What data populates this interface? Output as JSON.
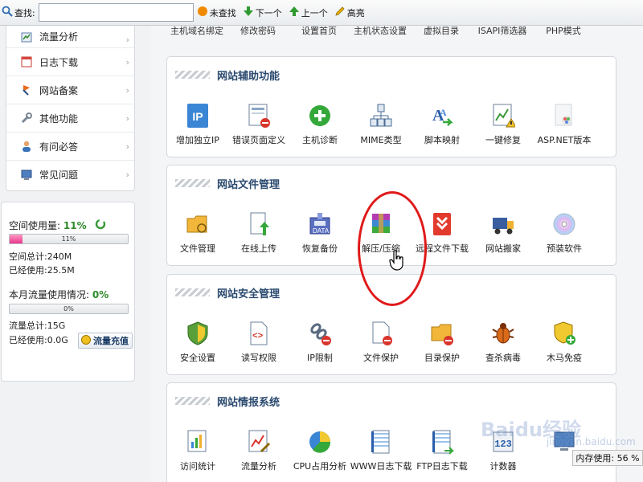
{
  "findbar": {
    "label": "查找:",
    "input_value": "",
    "buttons": [
      {
        "name": "not-found",
        "label": "未查找"
      },
      {
        "name": "next",
        "label": "下一个"
      },
      {
        "name": "prev",
        "label": "上一个"
      },
      {
        "name": "highlight",
        "label": "高亮"
      }
    ]
  },
  "sidebar": {
    "items": [
      {
        "label": "流量分析",
        "icon": "chart-icon"
      },
      {
        "label": "日志下载",
        "icon": "calendar-icon"
      },
      {
        "label": "网站备案",
        "icon": "flag-icon"
      },
      {
        "label": "其他功能",
        "icon": "wrench-icon"
      },
      {
        "label": "有问必答",
        "icon": "user-icon"
      },
      {
        "label": "常见问题",
        "icon": "monitor-icon"
      }
    ],
    "usage": {
      "space_label": "空间使用量:",
      "space_pct": "11%",
      "space_fraction": 0.11,
      "space_bar_text": "11%",
      "space_total": "空间总计:240M",
      "space_used": "已经使用:25.5M",
      "traffic_label": "本月流量使用情况:",
      "traffic_pct": "0%",
      "traffic_fraction": 0,
      "traffic_bar_text": "0%",
      "traffic_total": "流量总计:15G",
      "traffic_used": "已经使用:0.0G",
      "recharge_label": "流量充值"
    }
  },
  "main": {
    "top_row": [
      "主机域名绑定",
      "修改密码",
      "设置首页",
      "主机状态设置",
      "虚拟目录",
      "ISAPI筛选器",
      "PHP模式"
    ],
    "panels": [
      {
        "title": "网站辅助功能",
        "tiles": [
          {
            "label": "增加独立IP",
            "icon": "ip-icon"
          },
          {
            "label": "错误页面定义",
            "icon": "error-page-icon"
          },
          {
            "label": "主机诊断",
            "icon": "plus-circle-icon"
          },
          {
            "label": "MIME类型",
            "icon": "mime-icon"
          },
          {
            "label": "脚本映射",
            "icon": "script-icon"
          },
          {
            "label": "一键修复",
            "icon": "repair-icon"
          },
          {
            "label": "ASP.NET版本",
            "icon": "aspnet-icon"
          }
        ]
      },
      {
        "title": "网站文件管理",
        "tiles": [
          {
            "label": "文件管理",
            "icon": "folder-icon"
          },
          {
            "label": "在线上传",
            "icon": "upload-icon"
          },
          {
            "label": "恢复备份",
            "icon": "restore-icon"
          },
          {
            "label": "解压/压缩",
            "icon": "archive-icon"
          },
          {
            "label": "远程文件下载",
            "icon": "download-icon"
          },
          {
            "label": "网站搬家",
            "icon": "truck-icon"
          },
          {
            "label": "预装软件",
            "icon": "disc-icon"
          }
        ]
      },
      {
        "title": "网站安全管理",
        "tiles": [
          {
            "label": "安全设置",
            "icon": "shield-icon"
          },
          {
            "label": "读写权限",
            "icon": "code-file-icon"
          },
          {
            "label": "IP限制",
            "icon": "link-icon"
          },
          {
            "label": "文件保护",
            "icon": "file-protect-icon"
          },
          {
            "label": "目录保护",
            "icon": "folder-protect-icon"
          },
          {
            "label": "查杀病毒",
            "icon": "bug-icon"
          },
          {
            "label": "木马免疫",
            "icon": "shield-plus-icon"
          }
        ]
      },
      {
        "title": "网站情报系统",
        "tiles": [
          {
            "label": "访问统计",
            "icon": "stats-icon"
          },
          {
            "label": "流量分析",
            "icon": "line-chart-icon"
          },
          {
            "label": "CPU占用分析",
            "icon": "pie-icon"
          },
          {
            "label": "WWW日志下载",
            "icon": "www-log-icon"
          },
          {
            "label": "FTP日志下载",
            "icon": "ftp-log-icon"
          },
          {
            "label": "计数器",
            "icon": "counter-icon"
          },
          {
            "label": "",
            "icon": "monitor-icon"
          }
        ]
      }
    ]
  },
  "statusbar": {
    "memory": "内存使用: 56 %"
  },
  "watermark": {
    "text": "Baidu经验",
    "sub": "jingyan.baidu.com"
  }
}
